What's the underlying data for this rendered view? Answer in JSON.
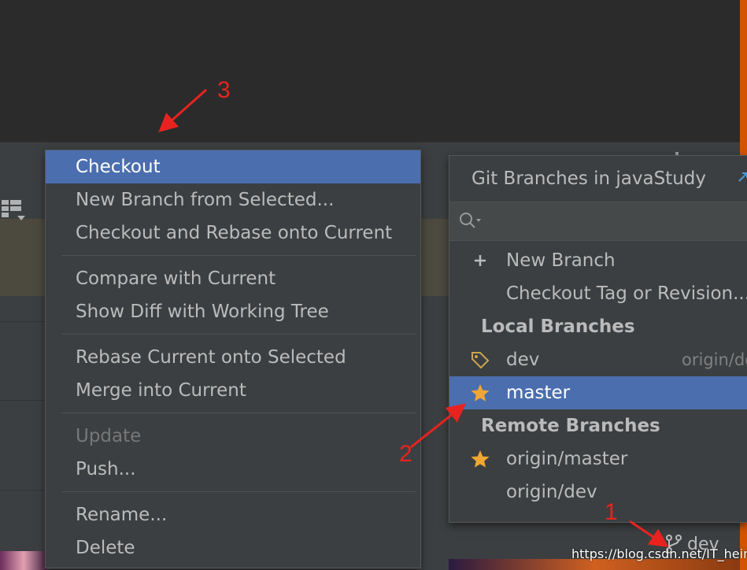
{
  "context_menu": {
    "items": [
      {
        "label": "Checkout",
        "state": "selected"
      },
      {
        "label": "New Branch from Selected..."
      },
      {
        "label": "Checkout and Rebase onto Current"
      },
      {
        "separator": true
      },
      {
        "label": "Compare with Current"
      },
      {
        "label": "Show Diff with Working Tree"
      },
      {
        "separator": true
      },
      {
        "label": "Rebase Current onto Selected"
      },
      {
        "label": "Merge into Current"
      },
      {
        "separator": true
      },
      {
        "label": "Update",
        "state": "disabled"
      },
      {
        "label": "Push..."
      },
      {
        "separator": true
      },
      {
        "label": "Rename..."
      },
      {
        "label": "Delete"
      }
    ]
  },
  "branches_popup": {
    "title": "Git Branches in javaStudy",
    "search_placeholder": "",
    "actions": {
      "new_branch": "New Branch",
      "checkout_tag": "Checkout Tag or Revision..."
    },
    "local_header": "Local Branches",
    "local_branches": {
      "dev": {
        "name": "dev",
        "tracking": "origin/dev",
        "icon": "tag-icon"
      },
      "master": {
        "name": "master",
        "icon": "star-icon",
        "selected": true
      }
    },
    "remote_header": "Remote Branches",
    "remote_branches": {
      "origin_master": {
        "name": "origin/master",
        "icon": "star-icon"
      },
      "origin_dev": {
        "name": "origin/dev"
      }
    }
  },
  "status_bar": {
    "branch_label": "dev",
    "branch_icon": "git-branch-icon"
  },
  "watermark": "https://blog.csdn.net/IT_heima",
  "annotations": {
    "one": "1",
    "two": "2",
    "three": "3"
  },
  "colors": {
    "selection": "#4b6eaf",
    "star": "#f0a732",
    "annotation": "#e8231f",
    "background": "#3c3f41"
  }
}
